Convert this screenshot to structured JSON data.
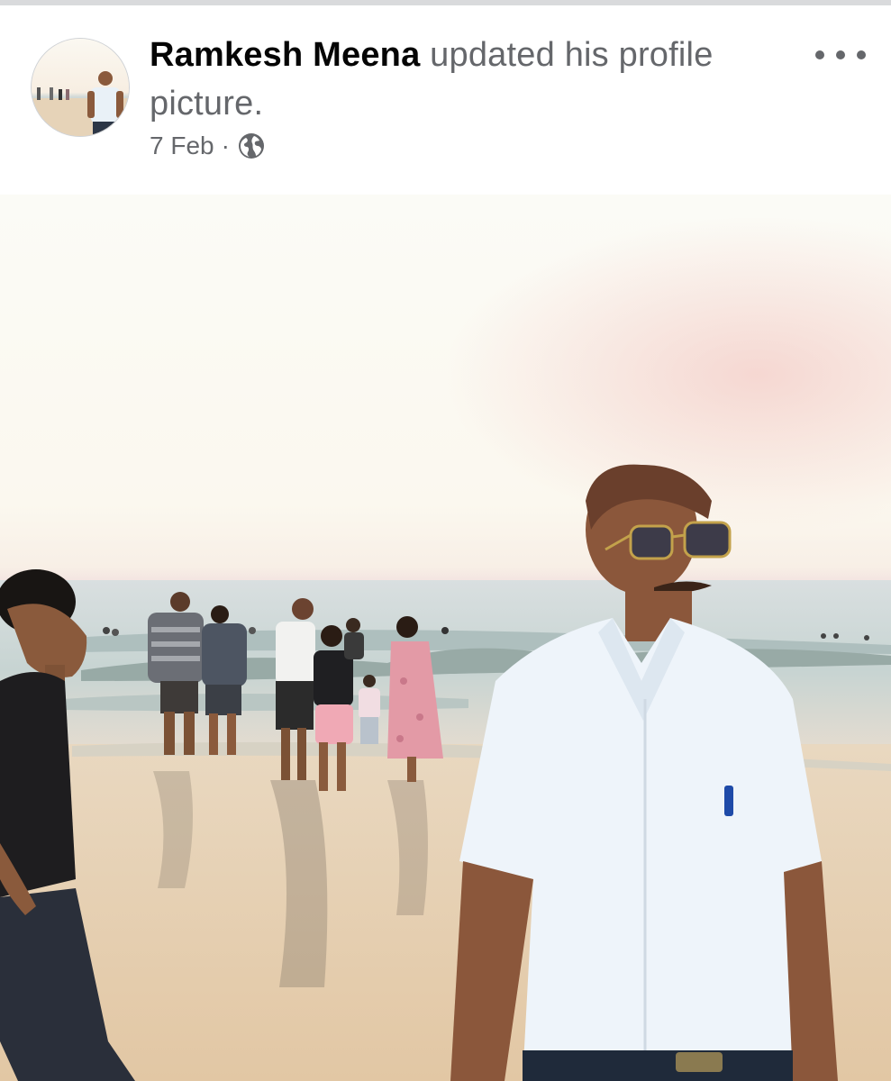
{
  "post": {
    "author": "Ramkesh Meena",
    "action_text": "updated his profile picture.",
    "date": "7 Feb",
    "separator": "·",
    "privacy_icon": "globe-icon",
    "more_icon": "more-options-icon",
    "avatar_icon": "profile-avatar"
  },
  "colors": {
    "author_text": "#050505",
    "secondary_text": "#65676b",
    "divider": "#d9dadc"
  }
}
